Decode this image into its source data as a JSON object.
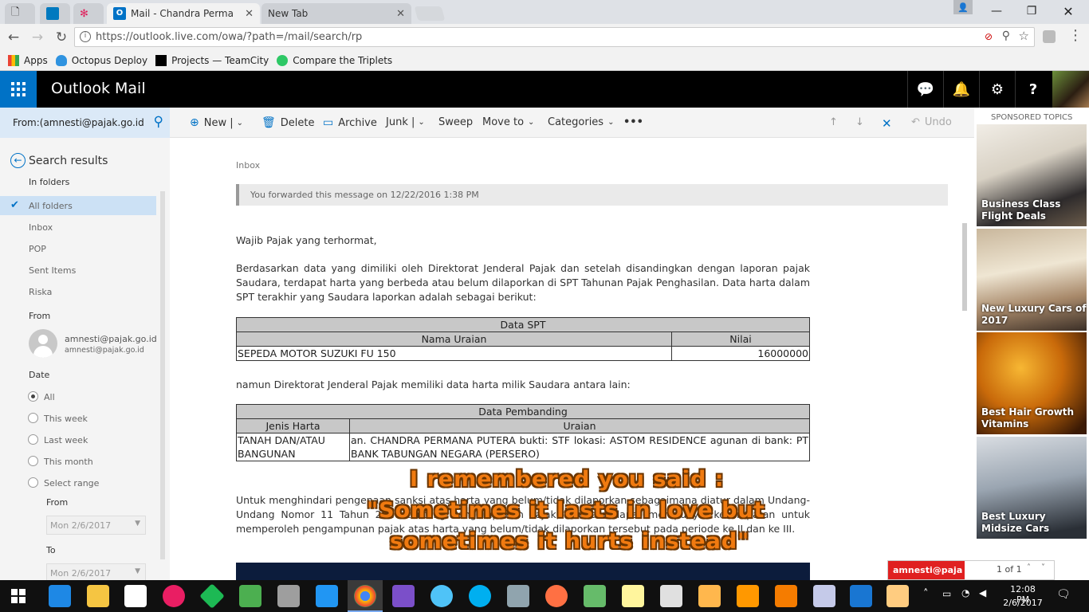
{
  "browser": {
    "tabs": [
      {
        "label": "Mail - Chandra Permana"
      },
      {
        "label": "New Tab"
      }
    ],
    "url": "https://outlook.live.com/owa/?path=/mail/search/rp",
    "bookmarks": [
      "Apps",
      "Octopus Deploy",
      "Projects — TeamCity",
      "Compare the Triplets"
    ]
  },
  "app": {
    "title": "Outlook Mail"
  },
  "search": {
    "value": "From:(amnesti@pajak.go.id"
  },
  "toolbar": {
    "new_label": "New |",
    "delete_label": "Delete",
    "archive_label": "Archive",
    "junk_label": "Junk |",
    "sweep_label": "Sweep",
    "move_label": "Move to",
    "categories_label": "Categories",
    "more_label": "•••",
    "undo_label": "Undo"
  },
  "leftpane": {
    "back_label": "Search results",
    "in_folders": "In folders",
    "folders": [
      "All folders",
      "Inbox",
      "POP",
      "Sent Items",
      "Riska"
    ],
    "from_head": "From",
    "from_name": "amnesti@pajak.go.id",
    "from_email": "amnesti@pajak.go.id",
    "date_head": "Date",
    "date_options": [
      "All",
      "This week",
      "Last week",
      "This month",
      "Select range"
    ],
    "selected_date": "All",
    "from_label": "From",
    "to_label": "To",
    "from_date": "Mon 2/6/2017",
    "to_date": "Mon 2/6/2017"
  },
  "message": {
    "folder": "Inbox",
    "forward_note": "You forwarded this message on 12/22/2016 1:38 PM",
    "greeting": "Wajib Pajak yang terhormat,",
    "para1": "Berdasarkan data yang dimiliki oleh Direktorat Jenderal Pajak dan setelah disandingkan dengan laporan pajak Saudara, terdapat harta yang berbeda atau belum dilaporkan di SPT Tahunan Pajak Penghasilan. Data harta dalam SPT terakhir yang Saudara laporkan adalah sebagai berikut:",
    "table1": {
      "title": "Data SPT",
      "col1": "Nama Uraian",
      "col2": "Nilai",
      "row_name": "SEPEDA MOTOR SUZUKI FU 150",
      "row_value": "16000000"
    },
    "para2": "namun Direktorat Jenderal Pajak memiliki data harta milik Saudara antara lain:",
    "table2": {
      "title": "Data Pembanding",
      "col1": "Jenis Harta",
      "col2": "Uraian",
      "row_type": "TANAH DAN/ATAU BANGUNAN",
      "row_desc": "an. CHANDRA PERMANA PUTERA bukti: STF lokasi: ASTOM RESIDENCE agunan di bank: PT BANK TABUNGAN NEGARA (PERSERO)"
    },
    "para3": "Untuk menghindari pengenaan sanksi atas harta yang belum/tidak dilaporkan sebagaimana diatur dalam Undang-Undang Nomor 11 Tahun 2016 tentang Pengampunan Pajak, Saudara dapat mempunyai kesempatan untuk memperoleh pengampunan pajak atas harta yang belum/tidak dilaporkan tersebut pada periode ke II dan ke III."
  },
  "overlay": {
    "line1": "I remembered you said :",
    "line2": "\"Sometimes it lasts in love but",
    "line3": "sometimes it hurts instead\""
  },
  "ads": {
    "heading": "SPONSORED TOPICS",
    "items": [
      {
        "caption": "Business Class Flight Deals"
      },
      {
        "caption": "New Luxury Cars of 2017"
      },
      {
        "caption": "Best Hair Growth Vitamins"
      },
      {
        "caption": "Best Luxury Midsize Cars"
      }
    ]
  },
  "chat": {
    "name": "amnesti@paja",
    "count": "1 of 1"
  },
  "clock": {
    "time": "12:08 PM",
    "date": "2/6/2017"
  },
  "colors": {
    "outlook_blue": "#0072c6",
    "header_black": "#000000",
    "overlay_orange": "#f07a10"
  }
}
